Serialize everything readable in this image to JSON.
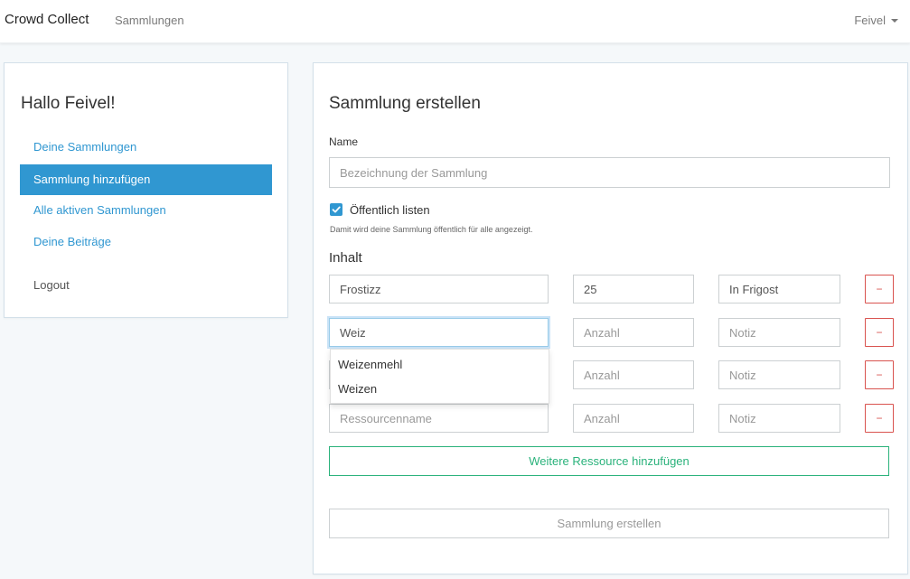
{
  "navbar": {
    "brand": "Crowd Collect",
    "nav_link": "Sammlungen",
    "user": "Feivel"
  },
  "sidebar": {
    "greeting": "Hallo Feivel!",
    "items": [
      {
        "label": "Deine Sammlungen",
        "active": false
      },
      {
        "label": "Sammlung hinzufügen",
        "active": true
      },
      {
        "label": "Alle aktiven Sammlungen",
        "active": false
      },
      {
        "label": "Deine Beiträge",
        "active": false
      }
    ],
    "logout": "Logout"
  },
  "form": {
    "title": "Sammlung erstellen",
    "name_label": "Name",
    "name_placeholder": "Bezeichnung der Sammlung",
    "public_checkbox_label": "Öffentlich listen",
    "public_checked": true,
    "public_help": "Damit wird deine Sammlung öffentlich für alle angezeigt.",
    "content_label": "Inhalt",
    "resources": [
      {
        "name_value": "Frostizz",
        "name_placeholder": "Ressourcenname",
        "amount_value": "25",
        "amount_placeholder": "Anzahl",
        "note_value": "In Frigost",
        "note_placeholder": "Notiz"
      },
      {
        "name_value": "Weiz",
        "name_placeholder": "Ressourcenname",
        "amount_value": "",
        "amount_placeholder": "Anzahl",
        "note_value": "",
        "note_placeholder": "Notiz"
      },
      {
        "name_value": "",
        "name_placeholder": "Ressourcenname",
        "amount_value": "",
        "amount_placeholder": "Anzahl",
        "note_value": "",
        "note_placeholder": "Notiz"
      },
      {
        "name_value": "",
        "name_placeholder": "Ressourcenname",
        "amount_value": "",
        "amount_placeholder": "Anzahl",
        "note_value": "",
        "note_placeholder": "Notiz"
      }
    ],
    "remove_label": "−",
    "autocomplete": [
      "Weizenmehl",
      "Weizen"
    ],
    "add_resource_label": "Weitere Ressource hinzufügen",
    "submit_label": "Sammlung erstellen"
  },
  "colors": {
    "primary": "#3097d1",
    "success": "#2ab27b",
    "danger": "#d9534f",
    "background": "#f5f8fa"
  }
}
